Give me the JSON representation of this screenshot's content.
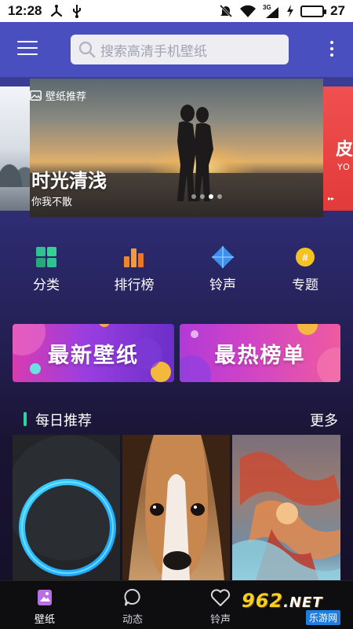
{
  "status_bar": {
    "time": "12:28",
    "battery_level": "27",
    "battery_fill": 0.3,
    "icons": [
      "share-icon",
      "usb-icon",
      "mute-icon",
      "wifi-icon",
      "signal-3g-icon",
      "charging-icon"
    ],
    "network_label": "3G"
  },
  "top_bar": {
    "search_placeholder": "搜索高清手机壁纸",
    "menu_icon": "hamburger-icon",
    "more_icon": "more-vertical-icon"
  },
  "banner": {
    "tag": "壁纸推荐",
    "title": "时光清浅",
    "subtitle": "你我不散",
    "right_peek_text": "皮",
    "right_peek_sub": "YO",
    "dots": 4,
    "active_dot": 2
  },
  "quick_nav": [
    {
      "label": "分类",
      "icon": "grid-icon"
    },
    {
      "label": "排行榜",
      "icon": "bar-chart-icon"
    },
    {
      "label": "铃声",
      "icon": "diamond-icon"
    },
    {
      "label": "专题",
      "icon": "hashtag-icon"
    }
  ],
  "promos": {
    "new_label": "最新壁纸",
    "hot_label": "最热榜单"
  },
  "daily": {
    "title": "每日推荐",
    "more": "更多"
  },
  "bottom_nav": [
    {
      "label": "壁纸",
      "icon": "wallpaper-icon",
      "active": true
    },
    {
      "label": "动态",
      "icon": "chat-bubble-icon",
      "active": false
    },
    {
      "label": "铃声",
      "icon": "heart-icon",
      "active": false
    }
  ],
  "watermark": {
    "number": "962",
    "domain": ".NET",
    "site": "乐游网"
  },
  "colors": {
    "topbar": "#4a4fc0",
    "accent_green": "#2fd3a0",
    "background": "#1a1434"
  }
}
